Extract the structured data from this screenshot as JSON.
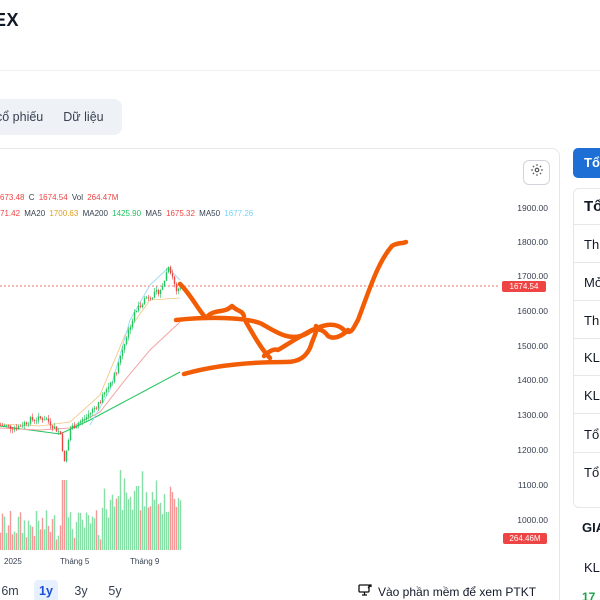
{
  "header": {
    "title": "EX",
    "subtitle": ""
  },
  "tabs": [
    "cổ phiếu",
    "Dữ liệu"
  ],
  "chart_info": {
    "ohlc": {
      "h": "673.48",
      "c_label": "C",
      "c": "1674.54",
      "vol_label": "Vol",
      "vol": "264.47M"
    },
    "ma": {
      "ma10": "71.42",
      "ma20_label": "MA20",
      "ma20": "1700.63",
      "ma200_label": "MA200",
      "ma200": "1425.90",
      "ma5_label": "MA5",
      "ma5": "1675.32",
      "ma50_label": "MA50",
      "ma50": "1677.26"
    },
    "current_price": "1674.54",
    "volume_tag": "264.46M",
    "x_ticks": [
      "2025",
      "Tháng 5",
      "Tháng 9"
    ],
    "y_ticks": [
      "1900.00",
      "1800.00",
      "1700.00",
      "1600.00",
      "1500.00",
      "1400.00",
      "1300.00",
      "1200.00",
      "1100.00",
      "1000.00"
    ]
  },
  "periods": [
    {
      "label": "6m",
      "active": false
    },
    {
      "label": "1y",
      "active": true
    },
    {
      "label": "3y",
      "active": false
    },
    {
      "label": "5y",
      "active": false
    }
  ],
  "analysis_link": "Vào phần mềm để xem PTKT",
  "right_panel": {
    "button": "Tổ",
    "header": "Tổ",
    "rows": [
      "Th",
      "Mở",
      "Th",
      "KL",
      "KL",
      "Tổ",
      "Tổ"
    ],
    "section": "GIA",
    "section_row": "KL",
    "green_value": "17"
  },
  "colors": {
    "accent": "#1d6fd6",
    "up": "#22c55e",
    "down": "#ef4444",
    "ma20": "#e0a020",
    "ma200": "#22c55e",
    "ma50": "#7dd3fc",
    "ma5": "#ef4444",
    "annotation": "#f25c05"
  }
}
